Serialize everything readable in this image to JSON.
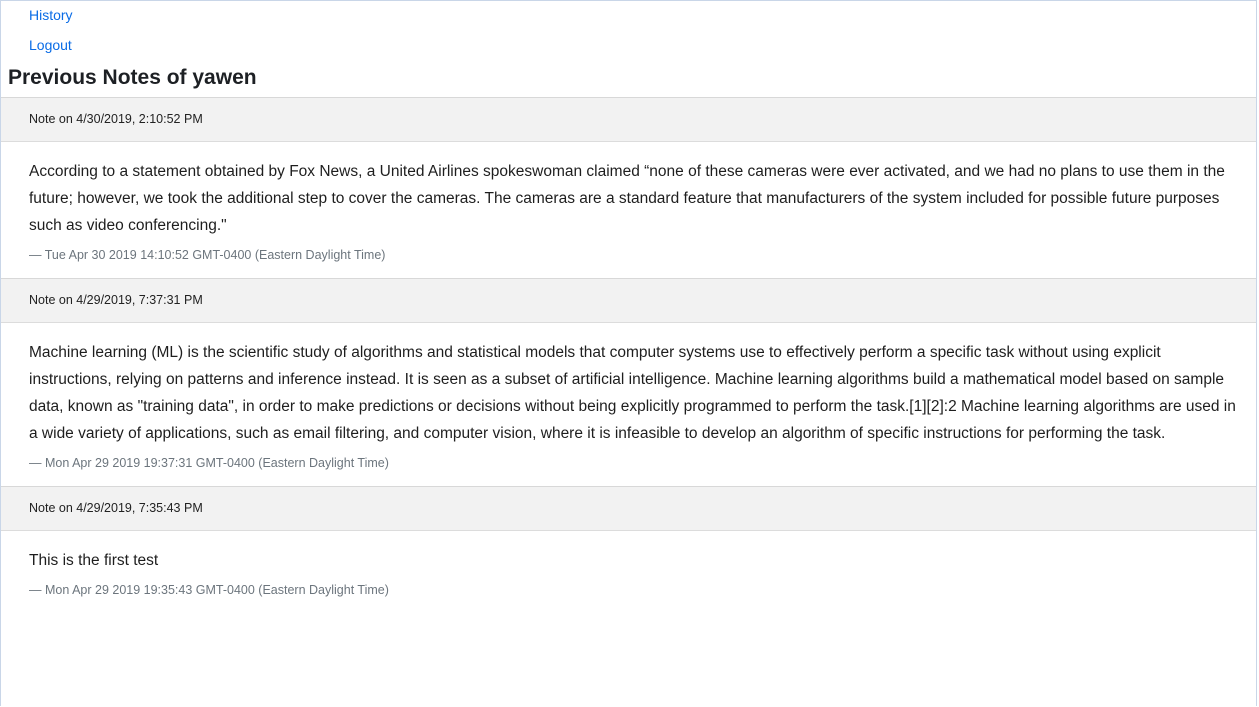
{
  "nav": {
    "history_label": "History",
    "logout_label": "Logout"
  },
  "page": {
    "title": "Previous Notes of yawen"
  },
  "notes": [
    {
      "header": "Note on 4/30/2019, 2:10:52 PM",
      "text": "According to a statement obtained by Fox News, a United Airlines spokeswoman claimed “none of these cameras were ever activated, and we had no plans to use them in the future; however, we took the additional step to cover the cameras. The cameras are a standard feature that manufacturers of the system included for possible future purposes such as video conferencing.\"",
      "footer": "— Tue Apr 30 2019 14:10:52 GMT-0400 (Eastern Daylight Time)"
    },
    {
      "header": "Note on 4/29/2019, 7:37:31 PM",
      "text": "Machine learning (ML) is the scientific study of algorithms and statistical models that computer systems use to effectively perform a specific task without using explicit instructions, relying on patterns and inference instead. It is seen as a subset of artificial intelligence. Machine learning algorithms build a mathematical model based on sample data, known as \"training data\", in order to make predictions or decisions without being explicitly programmed to perform the task.[1][2]:2 Machine learning algorithms are used in a wide variety of applications, such as email filtering, and computer vision, where it is infeasible to develop an algorithm of specific instructions for performing the task.",
      "footer": "— Mon Apr 29 2019 19:37:31 GMT-0400 (Eastern Daylight Time)"
    },
    {
      "header": "Note on 4/29/2019, 7:35:43 PM",
      "text": "This is the first test",
      "footer": "— Mon Apr 29 2019 19:35:43 GMT-0400 (Eastern Daylight Time)"
    }
  ],
  "colors": {
    "link": "#0a6ce6",
    "header_bg": "#f2f2f2",
    "muted_text": "#6c757d"
  }
}
